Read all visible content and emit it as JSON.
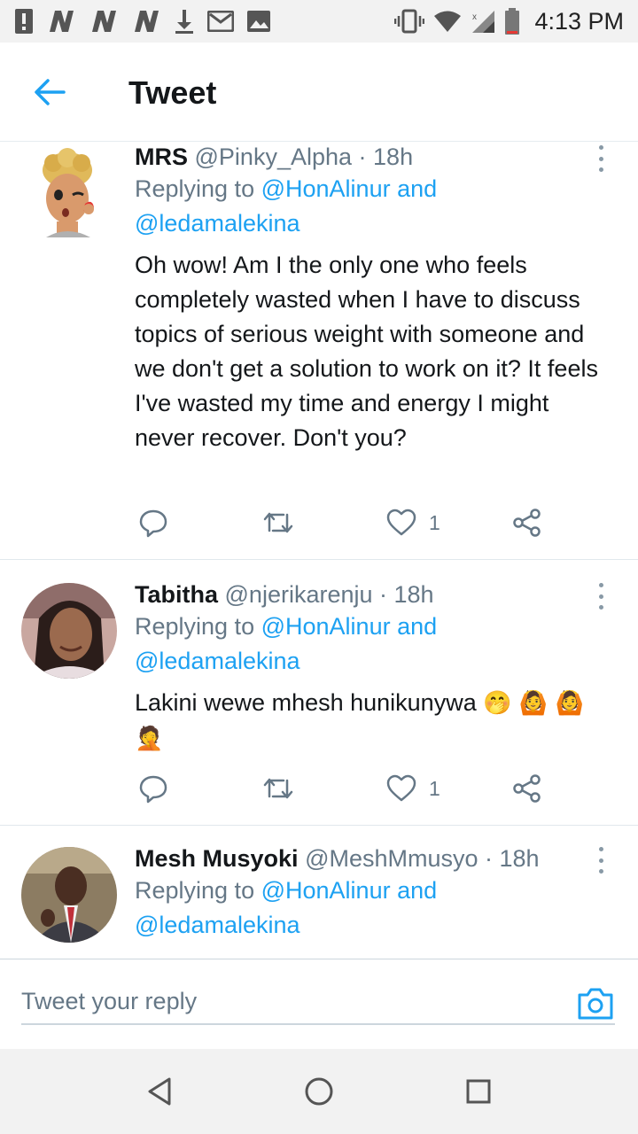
{
  "status_bar": {
    "time": "4:13 PM"
  },
  "header": {
    "title": "Tweet"
  },
  "reply_prefix": "Replying to",
  "reply_targets": [
    "@HonAlinur",
    "and",
    "@ledamalekina"
  ],
  "tweets": [
    {
      "name": "MRS",
      "handle": "@Pinky_Alpha",
      "time": "· 18h",
      "body": "Oh wow! Am I the only one who feels completely wasted when I have to discuss topics of serious weight with someone and we don't get a solution to work on it? It feels I've wasted my time and energy I might never recover. Don't you?",
      "likes": "1"
    },
    {
      "name": "Tabitha",
      "handle": "@njerikarenju",
      "time": "· 18h",
      "body": "Lakini wewe mhesh hunikunywa",
      "emojis": "🤭 🙆 🙆 🤦",
      "likes": "1"
    },
    {
      "name": "Mesh Musyoki",
      "handle": "@MeshMmusyo",
      "time": "· 18h"
    }
  ],
  "compose": {
    "placeholder": "Tweet your reply"
  },
  "colors": {
    "accent": "#1da1f2",
    "secondary_text": "#657786",
    "primary_text": "#14171a"
  }
}
